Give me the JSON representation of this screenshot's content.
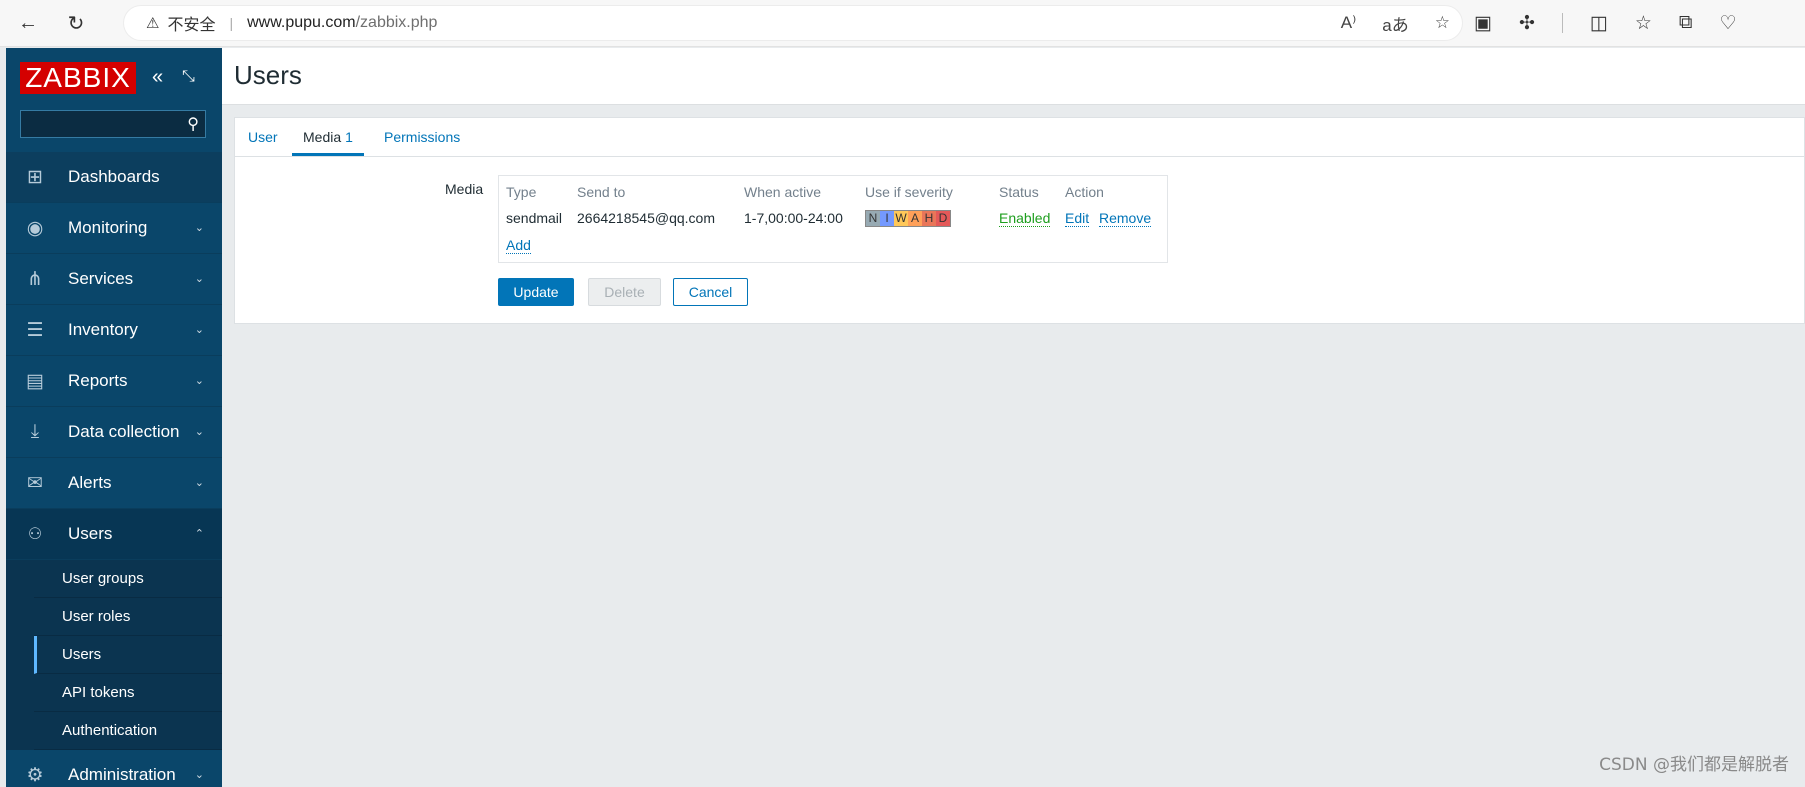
{
  "browser": {
    "back_icon": "←",
    "reload_icon": "↻",
    "security_warning": "不安全",
    "url_host": "www.pupu.com",
    "url_path": "/zabbix.php"
  },
  "sidebar": {
    "logo_text": "ZABBIX",
    "search_placeholder": "",
    "items": [
      {
        "label": "Dashboards",
        "icon": "dashboard-icon",
        "glyph": "⊞"
      },
      {
        "label": "Monitoring",
        "icon": "eye-icon",
        "glyph": "◉"
      },
      {
        "label": "Services",
        "icon": "services-icon",
        "glyph": "⋔"
      },
      {
        "label": "Inventory",
        "icon": "list-icon",
        "glyph": "☰"
      },
      {
        "label": "Reports",
        "icon": "report-icon",
        "glyph": "▤"
      },
      {
        "label": "Data collection",
        "icon": "download-icon",
        "glyph": "⤓"
      },
      {
        "label": "Alerts",
        "icon": "envelope-icon",
        "glyph": "✉"
      },
      {
        "label": "Users",
        "icon": "users-icon",
        "glyph": "👥"
      },
      {
        "label": "Administration",
        "icon": "gear-icon",
        "glyph": "⚙"
      }
    ],
    "users_submenu": [
      "User groups",
      "User roles",
      "Users",
      "API tokens",
      "Authentication"
    ]
  },
  "header": {
    "title": "Users"
  },
  "tabs": [
    {
      "label": "User"
    },
    {
      "label": "Media",
      "count": "1"
    },
    {
      "label": "Permissions"
    }
  ],
  "media": {
    "label": "Media",
    "columns": [
      "Type",
      "Send to",
      "When active",
      "Use if severity",
      "Status",
      "Action"
    ],
    "row": {
      "type": "sendmail",
      "send_to": "2664218545@qq.com",
      "when_active": "1-7,00:00-24:00",
      "severity": [
        {
          "letter": "N",
          "color": "#97aab3"
        },
        {
          "letter": "I",
          "color": "#7499ff"
        },
        {
          "letter": "W",
          "color": "#ffc859"
        },
        {
          "letter": "A",
          "color": "#ffa059"
        },
        {
          "letter": "H",
          "color": "#e97659"
        },
        {
          "letter": "D",
          "color": "#e45959"
        }
      ],
      "status": "Enabled",
      "edit": "Edit",
      "remove": "Remove"
    },
    "add": "Add"
  },
  "buttons": {
    "update": "Update",
    "delete": "Delete",
    "cancel": "Cancel"
  },
  "watermark": "CSDN @我们都是解脱者"
}
